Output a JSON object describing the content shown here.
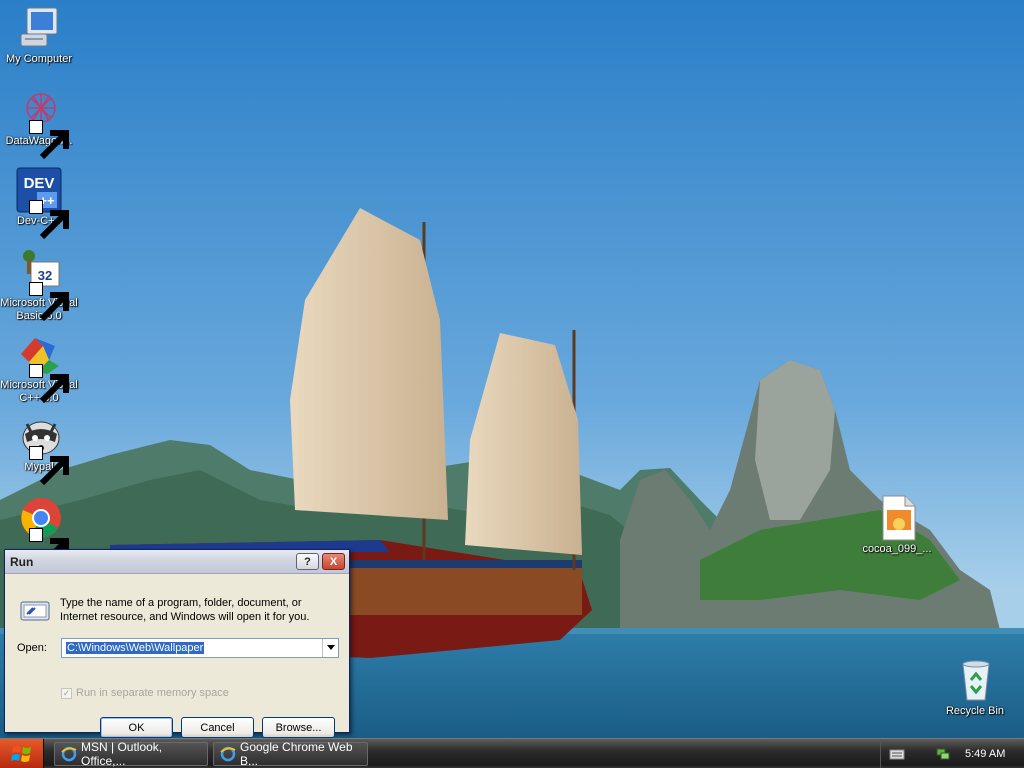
{
  "desktop": {
    "icons": [
      {
        "label": "My Computer"
      },
      {
        "label": "DataWagon..."
      },
      {
        "label": "Dev-C++"
      },
      {
        "label": "Microsoft Visual Basic 6.0"
      },
      {
        "label": "Microsoft Visual C++ 6.0"
      },
      {
        "label": "Mypal"
      },
      {
        "label": "cocoa_099_..."
      },
      {
        "label": "Recycle Bin"
      }
    ]
  },
  "run_dialog": {
    "title": "Run",
    "help_label": "?",
    "close_label": "X",
    "description": "Type the name of a program, folder, document, or Internet resource, and Windows will open it for you.",
    "open_label": "Open:",
    "open_value": "C:\\Windows\\Web\\Wallpaper",
    "separate_memory_label": "Run in separate memory space",
    "separate_memory_checked": true,
    "separate_memory_enabled": false,
    "buttons": {
      "ok": "OK",
      "cancel": "Cancel",
      "browse": "Browse..."
    }
  },
  "taskbar": {
    "tasks": [
      {
        "label": "MSN | Outlook, Office,...",
        "icon": "ie-icon"
      },
      {
        "label": "Google Chrome Web B...",
        "icon": "ie-icon"
      }
    ],
    "clock": "5:49 AM",
    "tray_icons": [
      "keyboard-icon",
      "network-icon"
    ]
  },
  "colors": {
    "dialog_bg": "#ece9d8",
    "selection": "#316ac5",
    "taskbar": "#2c2c2c",
    "start_button": "#d8461e"
  }
}
